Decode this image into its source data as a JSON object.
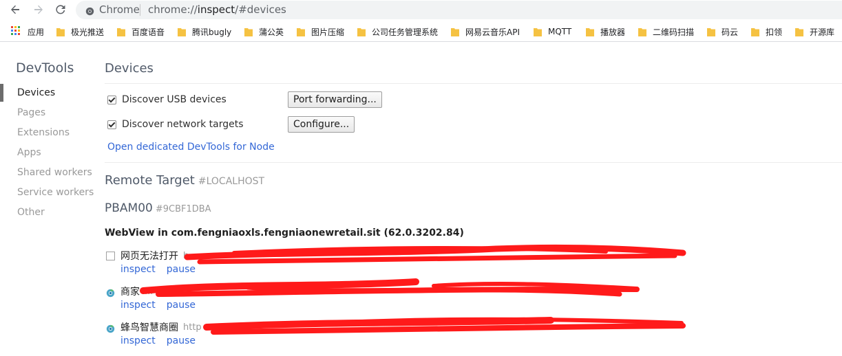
{
  "browser": {
    "omnibox_label": "Chrome",
    "url_prefix": "chrome://",
    "url_host": "inspect",
    "url_path": "/#devices"
  },
  "bookmarks": [
    {
      "label": "应用",
      "icon": "apps-grid-icon"
    },
    {
      "label": "极光推送",
      "icon": "folder-icon"
    },
    {
      "label": "百度语音",
      "icon": "folder-icon"
    },
    {
      "label": "腾讯bugly",
      "icon": "folder-icon"
    },
    {
      "label": "蒲公英",
      "icon": "folder-icon"
    },
    {
      "label": "图片压缩",
      "icon": "folder-icon"
    },
    {
      "label": "公司任务管理系统",
      "icon": "folder-icon"
    },
    {
      "label": "网易云音乐API",
      "icon": "folder-icon"
    },
    {
      "label": "MQTT",
      "icon": "folder-icon"
    },
    {
      "label": "播放器",
      "icon": "folder-icon"
    },
    {
      "label": "二维码扫描",
      "icon": "folder-icon"
    },
    {
      "label": "码云",
      "icon": "folder-icon"
    },
    {
      "label": "扣领",
      "icon": "folder-icon"
    },
    {
      "label": "开源库",
      "icon": "folder-icon"
    }
  ],
  "sidebar": {
    "title": "DevTools",
    "items": [
      {
        "label": "Devices",
        "active": true
      },
      {
        "label": "Pages"
      },
      {
        "label": "Extensions"
      },
      {
        "label": "Apps"
      },
      {
        "label": "Shared workers"
      },
      {
        "label": "Service workers"
      },
      {
        "label": "Other"
      }
    ]
  },
  "main": {
    "title": "Devices",
    "discover_usb": {
      "label": "Discover USB devices",
      "checked": true
    },
    "discover_network": {
      "label": "Discover network targets",
      "checked": true
    },
    "port_forwarding_button": "Port forwarding...",
    "configure_button": "Configure...",
    "open_node_link": "Open dedicated DevTools for Node",
    "remote_target": {
      "title": "Remote Target",
      "tag": "#LOCALHOST"
    },
    "device": {
      "name": "PBAM00",
      "serial": "#9CBF1DBA"
    },
    "webview_title": "WebView in com.fengniaoxls.fengniaonewretail.sit (62.0.3202.84)",
    "targets": [
      {
        "name": "网页无法打开",
        "url": "h...",
        "icon": "blank-page-icon",
        "inspect": "inspect",
        "pause": "pause"
      },
      {
        "name": "商家",
        "url": "...",
        "icon": "chrome-favicon-icon",
        "inspect": "inspect",
        "pause": "pause"
      },
      {
        "name": "蜂鸟智慧商圈",
        "url": "http",
        "icon": "chrome-favicon-icon",
        "inspect": "inspect",
        "pause": "pause"
      }
    ]
  },
  "colors": {
    "link": "#3367d6",
    "heading": "#505a69",
    "redaction": "#ff1a1a"
  }
}
